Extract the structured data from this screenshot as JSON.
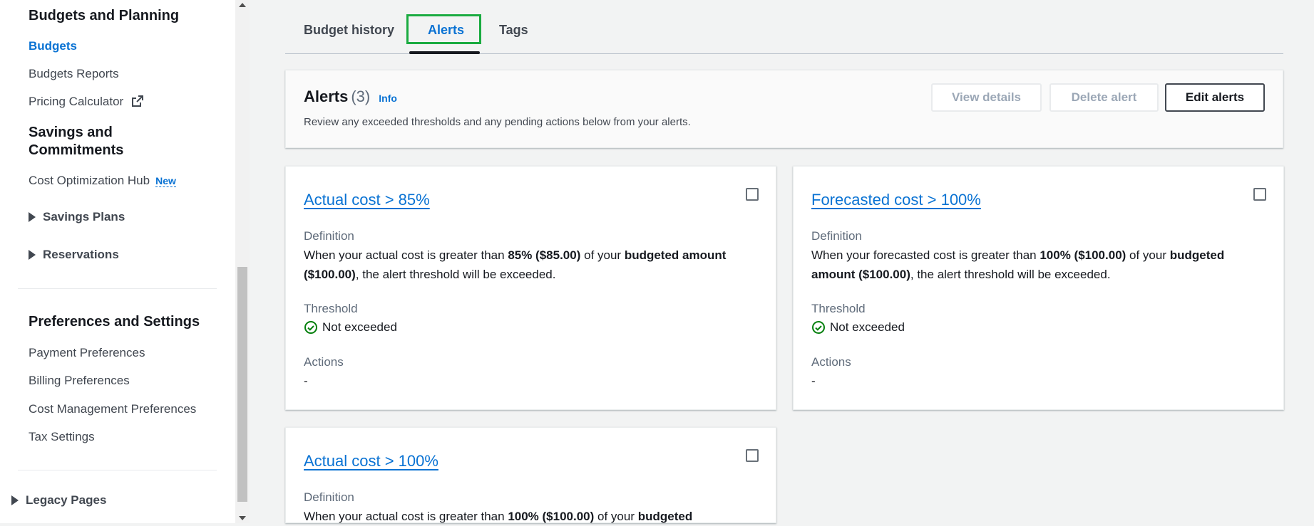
{
  "sidebar": {
    "section1_heading": "Budgets and Planning",
    "budgets": "Budgets",
    "budgets_reports": "Budgets Reports",
    "pricing_calculator": "Pricing Calculator",
    "section2_heading_line1": "Savings and",
    "section2_heading_line2": "Commitments",
    "cost_optimization_hub": "Cost Optimization Hub",
    "new_badge": "New",
    "savings_plans": "Savings Plans",
    "reservations": "Reservations",
    "section3_heading": "Preferences and Settings",
    "payment_preferences": "Payment Preferences",
    "billing_preferences": "Billing Preferences",
    "cost_management_preferences": "Cost Management Preferences",
    "tax_settings": "Tax Settings",
    "legacy_pages": "Legacy Pages"
  },
  "tabs": {
    "budget_history": "Budget history",
    "alerts": "Alerts",
    "tags": "Tags"
  },
  "alerts_header": {
    "title": "Alerts",
    "count": "(3)",
    "info": "Info",
    "description": "Review any exceeded thresholds and any pending actions below from your alerts.",
    "view_details": "View details",
    "delete_alert": "Delete alert",
    "edit_alerts": "Edit alerts"
  },
  "cards": [
    {
      "title": "Actual cost > 85%",
      "definition_label": "Definition",
      "def_a": "When your actual cost is greater than ",
      "def_b": "85% ($85.00)",
      "def_c": " of your ",
      "def_d": "budgeted amount ($100.00)",
      "def_e": ", the alert threshold will be exceeded.",
      "threshold_label": "Threshold",
      "threshold_status": "Not exceeded",
      "actions_label": "Actions",
      "actions_value": "-"
    },
    {
      "title": "Forecasted cost > 100%",
      "definition_label": "Definition",
      "def_a": "When your forecasted cost is greater than ",
      "def_b": "100% ($100.00)",
      "def_c": " of your ",
      "def_d": "budgeted amount ($100.00)",
      "def_e": ", the alert threshold will be exceeded.",
      "threshold_label": "Threshold",
      "threshold_status": "Not exceeded",
      "actions_label": "Actions",
      "actions_value": "-"
    },
    {
      "title": "Actual cost > 100%",
      "definition_label": "Definition",
      "def_a": "When your actual cost is greater than ",
      "def_b": "100% ($100.00)",
      "def_c": " of your ",
      "def_d": "budgeted"
    }
  ],
  "colors": {
    "link_blue": "#0972d3",
    "highlight_green": "#1aab40",
    "success_green": "#037f0c"
  }
}
